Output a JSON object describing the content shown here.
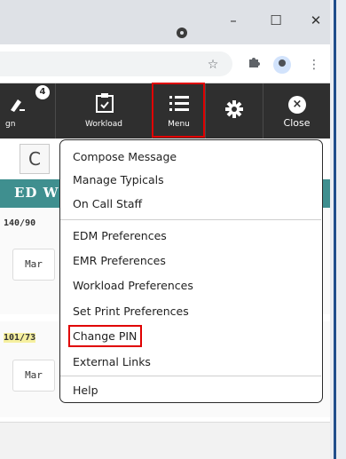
{
  "window_controls": {
    "minimize": "–",
    "maximize": "☐",
    "close": "✕"
  },
  "toolbar": {
    "tools": [
      {
        "label": "gn",
        "badge": "4"
      },
      {
        "label": "Workload"
      },
      {
        "label": "Menu"
      },
      {
        "label": ""
      },
      {
        "label": "Close"
      }
    ]
  },
  "page": {
    "refresh": "C",
    "header_text": "ED W",
    "vitals": [
      "140/90",
      "101/73"
    ],
    "dates": [
      "Mar",
      "Mar"
    ]
  },
  "menu": {
    "groups": [
      [
        "Compose Message",
        "Manage Typicals",
        "On Call Staff"
      ],
      [
        "EDM Preferences",
        "EMR Preferences",
        "Workload Preferences",
        "Set Print Preferences",
        "Change PIN",
        "External Links"
      ],
      [
        "Help"
      ]
    ]
  },
  "colors": {
    "toolbar": "#2f2f2f",
    "teal": "#3f8f8f",
    "highlight": "#e00000"
  }
}
